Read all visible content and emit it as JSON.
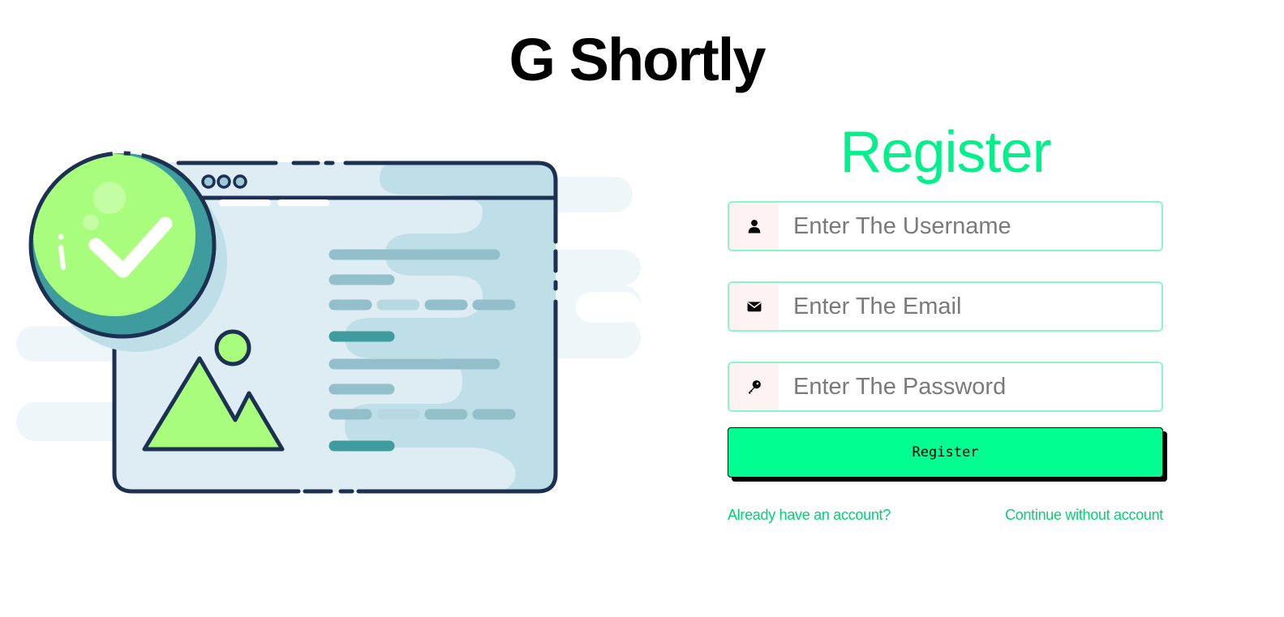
{
  "header": {
    "app_title": "G Shortly"
  },
  "form": {
    "heading": "Register",
    "fields": [
      {
        "icon": "user-icon",
        "placeholder": "Enter The Username",
        "value": ""
      },
      {
        "icon": "envelope-icon",
        "placeholder": "Enter The Email",
        "value": ""
      },
      {
        "icon": "key-icon",
        "placeholder": "Enter The Password",
        "value": ""
      }
    ],
    "submit_label": "Register",
    "login_link": "Already have an account?",
    "guest_link": "Continue without account"
  },
  "illustration": {
    "icon": "browser-window-with-checkmark-illustration"
  },
  "colors": {
    "accent": "#00f08c",
    "button": "#00ff90",
    "link": "#00d272",
    "input_border": "#8af5c9",
    "addon_bg": "#fdf3f2",
    "illustration_outline": "#1c3152",
    "illustration_green": "#a8fd7c",
    "illustration_teal": "#3f9c9e",
    "illustration_blue": "#bfdfe8"
  }
}
